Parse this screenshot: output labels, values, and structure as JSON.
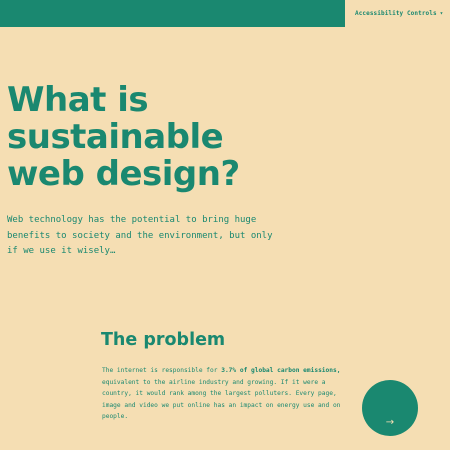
{
  "header": {
    "accessibility_label": "Accessibility Controls",
    "caret": "▾"
  },
  "hero": {
    "title": "What is sustainable web design?",
    "intro": "Web technology has the potential to bring huge benefits to society and the environment, but only if we use it wisely…"
  },
  "problem": {
    "heading": "The problem",
    "body_before": "The internet is responsible for",
    "highlight": "3.7% of global carbon emissions,",
    "body_after": "equivalent to the airline industry and growing. If it were a country, it would rank among the largest polluters. Every page, image and video we put online has an impact on energy use and on people."
  },
  "fab": {
    "arrow": "→"
  },
  "colors": {
    "background": "#f5deb3",
    "accent": "#1a8870"
  }
}
